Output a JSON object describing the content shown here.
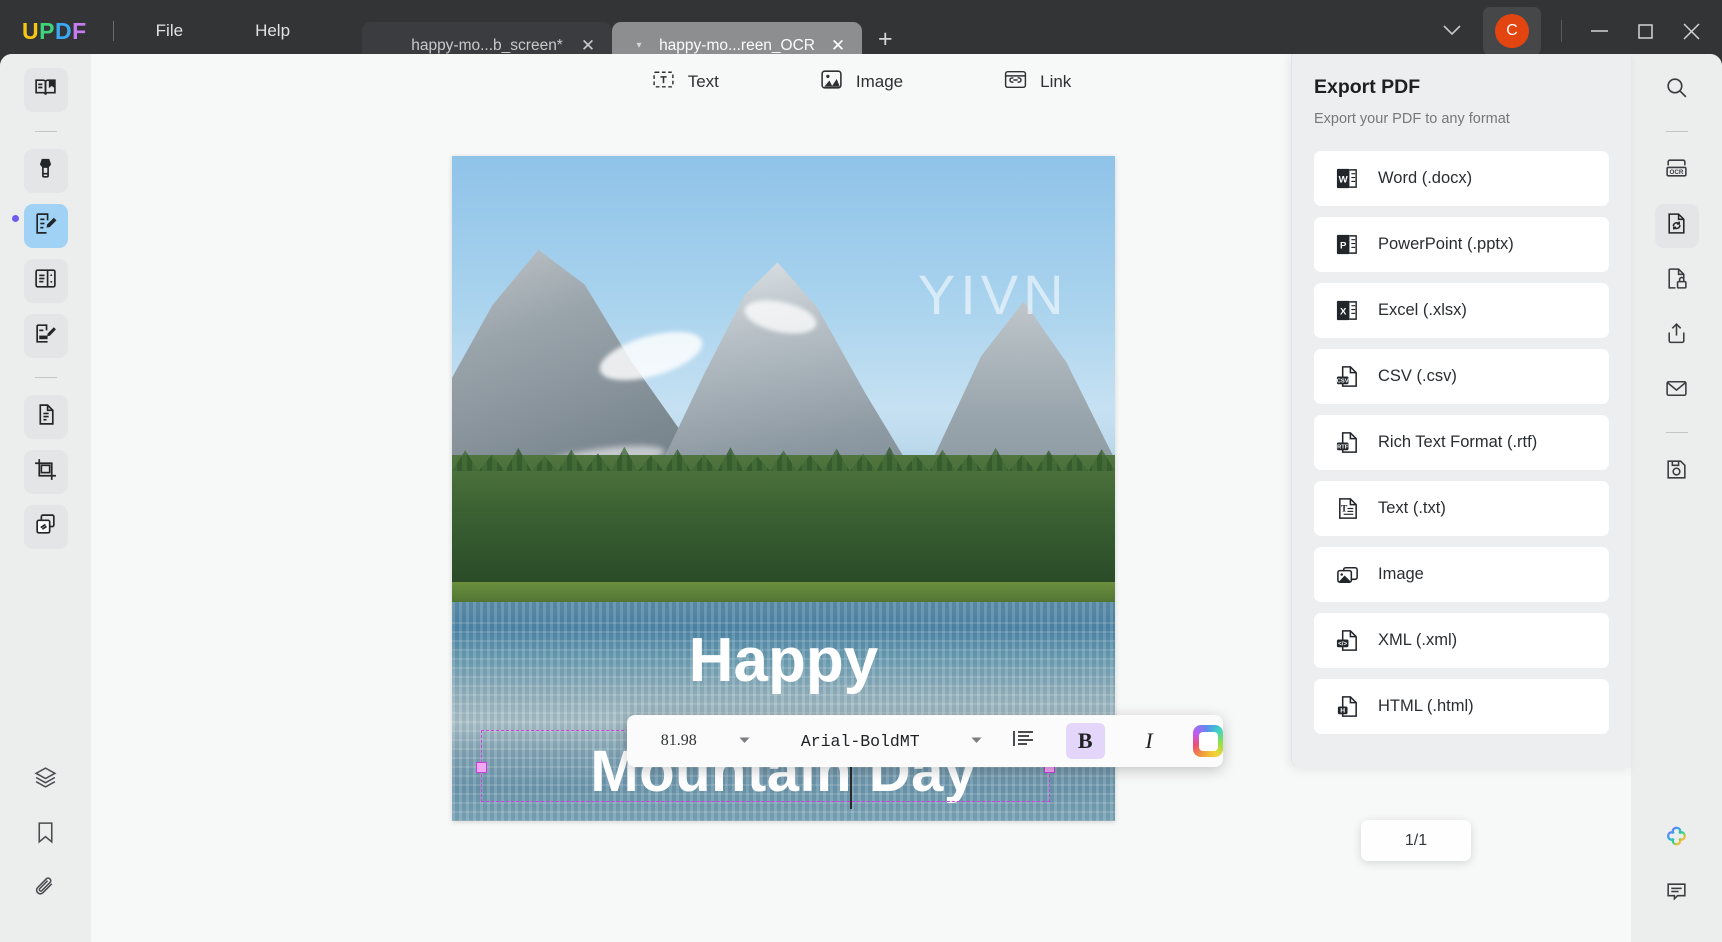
{
  "app": {
    "brand": {
      "c1": "U",
      "c2": "P",
      "c3": "D",
      "c4": "F"
    },
    "menu": [
      {
        "label": "File"
      },
      {
        "label": "Help"
      }
    ],
    "tabs": [
      {
        "title": "happy-mo...b_screen*",
        "active": false
      },
      {
        "title": "happy-mo...reen_OCR",
        "active": true
      }
    ],
    "new_tab_label": "+",
    "close_label": "✕",
    "caret_label": "▾",
    "account": {
      "initial": "C",
      "color": "#e2450f"
    }
  },
  "edit_toolbar": {
    "items": [
      {
        "label": "Text",
        "icon": "text-box-icon"
      },
      {
        "label": "Image",
        "icon": "image-icon"
      },
      {
        "label": "Link",
        "icon": "link-icon"
      }
    ]
  },
  "document": {
    "watermark": "YIVN",
    "headline_line1": "Happy",
    "headline_line2": "Mountain Day",
    "page_indicator": "1/1"
  },
  "format_toolbar": {
    "font_size": "81.98",
    "font_family": "Arial-BoldMT",
    "align_icon": "align-left-icon",
    "bold_label": "B",
    "bold_active": true,
    "italic_label": "I",
    "color_swatch": "rainbow",
    "caret": "▾"
  },
  "export_panel": {
    "title": "Export PDF",
    "subtitle": "Export your PDF to any format",
    "items": [
      {
        "label": "Word (.docx)",
        "icon": "word-icon",
        "badge": "W"
      },
      {
        "label": "PowerPoint (.pptx)",
        "icon": "powerpoint-icon",
        "badge": "P"
      },
      {
        "label": "Excel (.xlsx)",
        "icon": "excel-icon",
        "badge": "X"
      },
      {
        "label": "CSV (.csv)",
        "icon": "csv-icon",
        "badge": "CSV"
      },
      {
        "label": "Rich Text Format (.rtf)",
        "icon": "rtf-icon",
        "badge": "RTF"
      },
      {
        "label": "Text (.txt)",
        "icon": "txt-icon",
        "badge": "T"
      },
      {
        "label": "Image",
        "icon": "image-file-icon",
        "badge": ""
      },
      {
        "label": "XML (.xml)",
        "icon": "xml-icon",
        "badge": "</>"
      },
      {
        "label": "HTML (.html)",
        "icon": "html-icon",
        "badge": "H"
      }
    ]
  },
  "left_rail": {
    "items": [
      {
        "name": "reader-tool",
        "icon": "book-reader-icon",
        "active": false
      },
      {
        "name": "comment-tool",
        "icon": "highlighter-icon",
        "active": false
      },
      {
        "name": "edit-pdf-tool",
        "icon": "edit-document-icon",
        "active": true
      },
      {
        "name": "page-tool",
        "icon": "page-organize-icon",
        "active": false
      },
      {
        "name": "form-tool",
        "icon": "form-edit-icon",
        "active": false
      },
      {
        "name": "convert-tool",
        "icon": "convert-document-icon",
        "active": false
      },
      {
        "name": "crop-tool",
        "icon": "crop-icon",
        "active": false
      },
      {
        "name": "batch-tool",
        "icon": "batch-copy-icon",
        "active": false
      },
      {
        "name": "layers-tool",
        "icon": "layers-icon",
        "active": false
      },
      {
        "name": "bookmark-tool",
        "icon": "bookmark-icon",
        "active": false
      },
      {
        "name": "attachment-tool",
        "icon": "paperclip-icon",
        "active": false
      }
    ]
  },
  "right_rail": {
    "items": [
      {
        "name": "search",
        "icon": "search-icon",
        "active": false
      },
      {
        "name": "ocr",
        "icon": "ocr-icon",
        "active": false
      },
      {
        "name": "export",
        "icon": "export-convert-icon",
        "active": true
      },
      {
        "name": "protect",
        "icon": "document-lock-icon",
        "active": false
      },
      {
        "name": "share",
        "icon": "share-upload-icon",
        "active": false
      },
      {
        "name": "email",
        "icon": "envelope-icon",
        "active": false
      },
      {
        "name": "save",
        "icon": "save-floppy-icon",
        "active": false
      },
      {
        "name": "ai-assistant",
        "icon": "ai-clover-icon",
        "active": false
      },
      {
        "name": "comments",
        "icon": "comment-bubble-icon",
        "active": false
      }
    ]
  }
}
